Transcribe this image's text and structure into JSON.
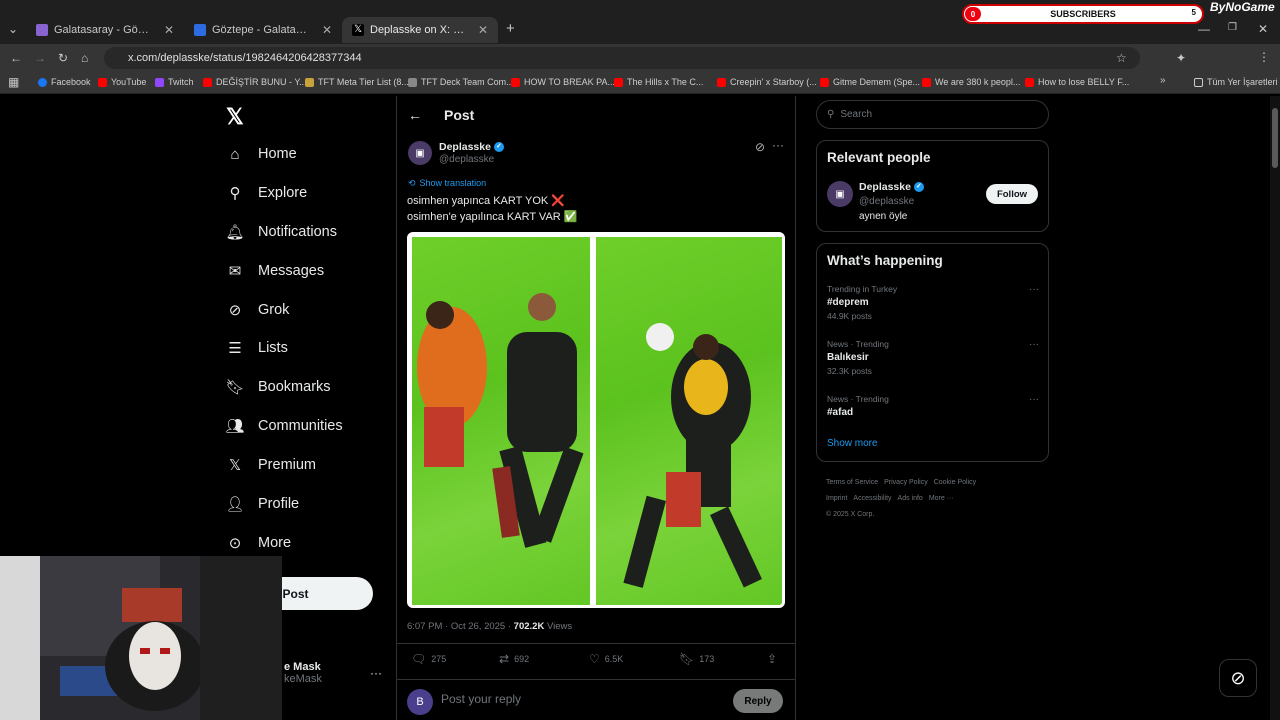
{
  "browser": {
    "tabs": [
      {
        "title": "Galatasaray - Göztepe Maç Öze",
        "color": "#8a63d2"
      },
      {
        "title": "Göztepe - Galatasaray SK takım",
        "color": "#2d6be0"
      },
      {
        "title": "Deplasske on X: \"osimhen yapın",
        "color": "#000000"
      }
    ],
    "url": "x.com/deplasske/status/1982464206428377344",
    "bookmarks": [
      "Facebook",
      "YouTube",
      "Twitch",
      "DEĞİŞTİR BUNU - Y...",
      "TFT Meta Tier List (8...",
      "TFT Deck Team Com...",
      "HOW TO BREAK PA...",
      "The Hills x The C...",
      "Creepin' x Starboy (...",
      "Gitme Demem (Spe...",
      "We are 380 k peopl...",
      "How to lose BELLY F...",
      "Tüm Yer İşaretleri"
    ]
  },
  "overlay": {
    "subscribers_label": "SUBSCRIBERS",
    "sub_left": "0",
    "sub_right": "5",
    "brand": "ByNoGame"
  },
  "nav": {
    "items": [
      "Home",
      "Explore",
      "Notifications",
      "Messages",
      "Grok",
      "Lists",
      "Bookmarks",
      "Communities",
      "Premium",
      "Profile",
      "More"
    ],
    "post_label": "Post",
    "me_name": "e Mask",
    "me_handle": "keMask"
  },
  "post": {
    "header": "Post",
    "author": "Deplasske",
    "handle": "@deplasske",
    "show_translation": "Show translation",
    "line1": "osimhen yapınca KART YOK ❌",
    "line2": "osimhen'e yapılınca KART VAR ✅",
    "time": "6:07 PM · Oct 26, 2025 · ",
    "views": "702.2K",
    "views_label": " Views",
    "replies": "275",
    "reposts": "692",
    "likes": "6.5K",
    "bookmarks": "173",
    "reply_avatar": "B",
    "reply_placeholder": "Post your reply",
    "reply_button": "Reply"
  },
  "sidebar": {
    "search_placeholder": "Search",
    "relevant_title": "Relevant people",
    "person_name": "Deplasske",
    "person_handle": "@deplasske",
    "person_bio": "aynen öyle",
    "follow_label": "Follow",
    "happening_title": "What’s happening",
    "trends": [
      {
        "category": "Trending in Turkey",
        "name": "#deprem",
        "count": "44.9K posts"
      },
      {
        "category": "News · Trending",
        "name": "Balıkesir",
        "count": "32.3K posts"
      },
      {
        "category": "News · Trending",
        "name": "#afad",
        "count": ""
      }
    ],
    "show_more": "Show more",
    "footer": [
      "Terms of Service",
      "Privacy Policy",
      "Cookie Policy",
      "Imprint",
      "Accessibility",
      "Ads info",
      "More ···",
      "© 2025 X Corp."
    ]
  }
}
